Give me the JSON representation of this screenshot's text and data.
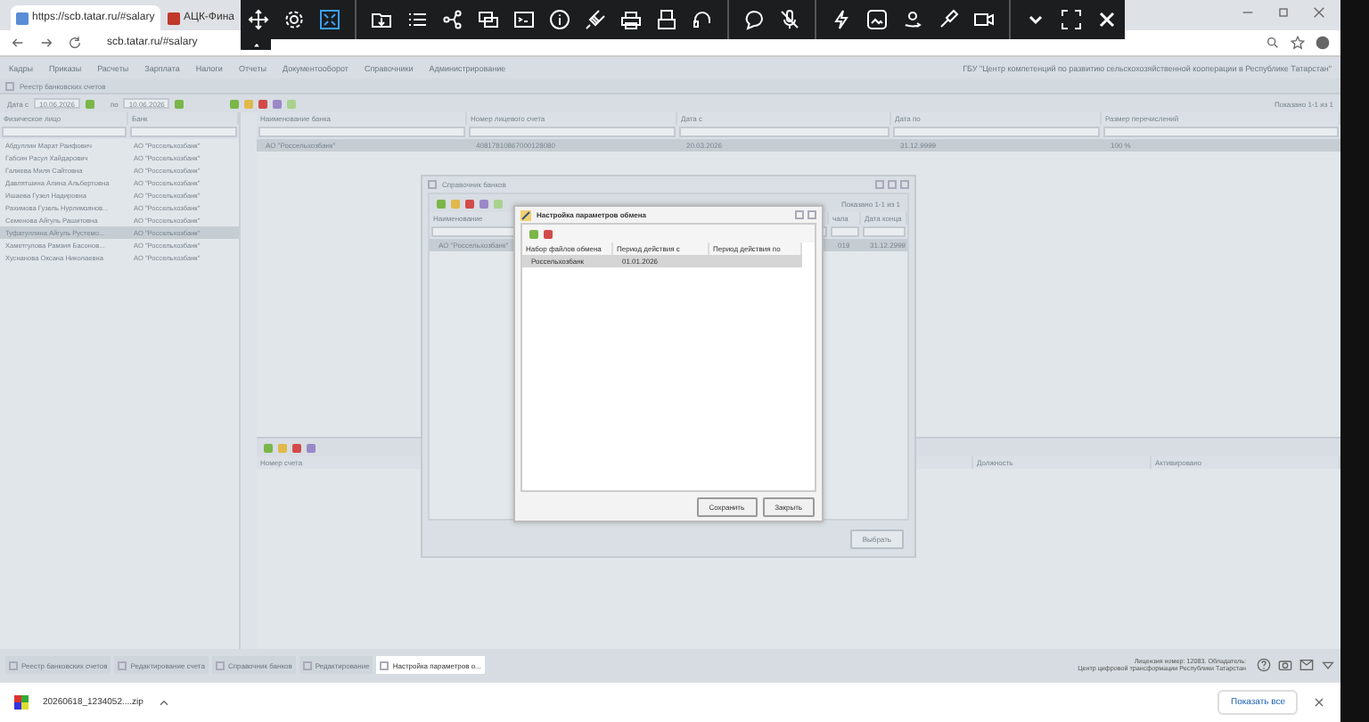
{
  "browser": {
    "tabs": [
      {
        "title": "https://scb.tatar.ru/#salary",
        "selected": true
      },
      {
        "title": "АЦК-Фина",
        "selected": false
      }
    ],
    "url": "scb.tatar.ru/#salary"
  },
  "menu": [
    "Кадры",
    "Приказы",
    "Расчеты",
    "Зарплата",
    "Налоги",
    "Отчеты",
    "Документооборот",
    "Справочники",
    "Администрирование"
  ],
  "organization": "ГБУ \"Центр компетенций по развитию сельскохозяйственной кооперации в Республике Татарстан\"",
  "registry": {
    "title": "Реестр банковских счетов",
    "date_from_label": "Дата с",
    "date_from": "10.06.2026",
    "date_to_label": "по",
    "date_to": "10.06.2026",
    "shown": "Показано 1-1 из 1",
    "people": {
      "columns": [
        "Физическое лицо",
        "Банк"
      ],
      "rows": [
        {
          "cells": [
            "Абдуллин Марат Раифович",
            "АО \"Россельхозбанк\""
          ],
          "selected": false
        },
        {
          "cells": [
            "Габсин Расул Хайдарович",
            "АО \"Россельхозбанк\""
          ],
          "selected": false
        },
        {
          "cells": [
            "Галиева Миля Сайтовна",
            "АО \"Россельхозбанк\""
          ],
          "selected": false
        },
        {
          "cells": [
            "Давлятшина Алина Альбертовна",
            "АО \"Россельхозбанк\""
          ],
          "selected": false
        },
        {
          "cells": [
            "Ишаева Гузел Надировна",
            "АО \"Россельхозбанк\""
          ],
          "selected": false
        },
        {
          "cells": [
            "Рахимова Гузель Нурлимзянов...",
            "АО \"Россельхозбанк\""
          ],
          "selected": false
        },
        {
          "cells": [
            "Семенова Айгуль Рашитовна",
            "АО \"Россельхозбанк\""
          ],
          "selected": false
        },
        {
          "cells": [
            "Туфатуллина Айгуль Рустемо...",
            "АО \"Россельхозбанк\""
          ],
          "selected": true
        },
        {
          "cells": [
            "Хаметгулова Рамзия Басонов...",
            "АО \"Россельхозбанк\""
          ],
          "selected": false
        },
        {
          "cells": [
            "Хуснанова Оксана Николаевна",
            "АО \"Россельхозбанк\""
          ],
          "selected": false
        }
      ]
    },
    "accounts": {
      "columns": [
        "Наименование банка",
        "Номер лицевого счета",
        "Дата с",
        "Дата по",
        "Размер перечислений"
      ],
      "rows": [
        {
          "cells": [
            "АО \"Россельхозбанк\"",
            "40817810867000128080",
            "20.03.2026",
            "31.12.9999",
            "100 %"
          ],
          "selected": true
        }
      ]
    },
    "details": {
      "columns": [
        "Номер счета",
        "Должность",
        "Активировано"
      ]
    }
  },
  "banks_dialog": {
    "title": "Справочник банков",
    "shown": "Показано 1-1 из 1",
    "columns": [
      "Наименование",
      "чала",
      "Дата конца"
    ],
    "rows": [
      {
        "cells": [
          "АО \"Россельхозбанк\"",
          "019",
          "31.12.2999"
        ],
        "selected": true
      }
    ],
    "button": "Выбрать"
  },
  "exchange_dialog": {
    "title": "Настройка параметров обмена",
    "columns": [
      "Набор файлов обмена",
      "Период действия с",
      "Период действия по"
    ],
    "rows": [
      {
        "cells": [
          "Россельхозбанк",
          "01.01.2026"
        ],
        "selected": true
      }
    ],
    "buttons": [
      "Сохранить",
      "Закрыть"
    ]
  },
  "taskbar": {
    "items": [
      {
        "label": "Реестр банковских счетов",
        "selected": false
      },
      {
        "label": "Редактирование счета",
        "selected": false
      },
      {
        "label": "Справочник банков",
        "selected": false
      },
      {
        "label": "Редактирование",
        "selected": false
      },
      {
        "label": "Настройка параметров о...",
        "selected": true
      }
    ],
    "license": [
      "Лицензия номер: 12083. Обладатель:",
      "Центр цифровой трансформации Республики Татарстан"
    ]
  },
  "downloads": {
    "file": "20260618_1234052....zip",
    "show_all": "Показать все"
  }
}
